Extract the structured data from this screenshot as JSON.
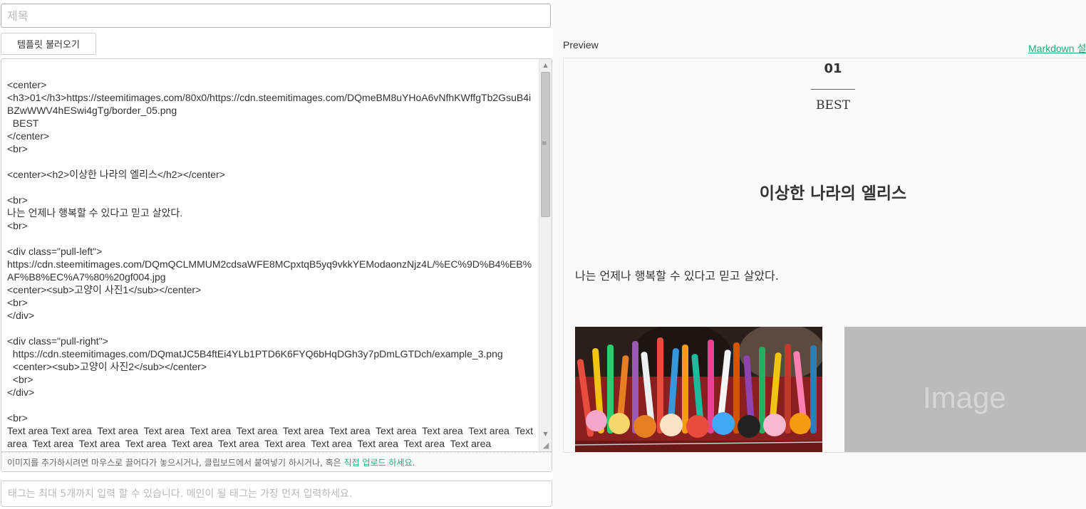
{
  "editor": {
    "title_placeholder": "제목",
    "template_button": "템플릿 불러오기",
    "body_text": "<center>\n<h3>01</h3>https://steemitimages.com/80x0/https://cdn.steemitimages.com/DQmeBM8uYHoA6vNfhKWffgTb2GsuB4iBZwWWV4hESwi4gTg/border_05.png\n  BEST\n</center>\n<br>\n\n<center><h2>이상한 나라의 엘리스</h2></center>\n\n<br>\n나는 언제나 행복할 수 있다고 믿고 살았다.\n<br>\n\n<div class=\"pull-left\">\nhttps://cdn.steemitimages.com/DQmQCLMMUM2cdsaWFE8MCpxtqB5yq9vkkYEModaonzNjz4L/%EC%9D%B4%EB%AF%B8%EC%A7%80%20gf004.jpg\n<center><sub>고양이 사진1</sub></center>\n<br>\n</div>\n\n<div class=\"pull-right\">\n  https://cdn.steemitimages.com/DQmatJC5B4ftEi4YLb1PTD6K6FYQ6bHqDGh3y7pDmLGTDch/example_3.png\n  <center><sub>고양이 사진2</sub></center>\n  <br>\n</div>\n\n<br>\nText area Text area  Text area  Text area  Text area  Text area  Text area  Text area  Text area  Text area  Text area  Text area  Text area  Text area  Text area  Text area  Text area  Text area  Text area  Text area  Text area  Text area",
    "upload_hint_prefix": "이미지를 추가하시려면 마우스로 끌어다가 놓으시거나, 클립보드에서 붙여넣기 하시거나, 혹은 ",
    "upload_hint_link": "직접 업로드 하세요",
    "upload_hint_suffix": ".",
    "tags_placeholder": "태그는 최대 5개까지 입력 할 수 있습니다. 메인이 될 태그는 가장 먼저 입력하세요."
  },
  "preview": {
    "label": "Preview",
    "markdown_link": "Markdown 설",
    "number": "01",
    "best": "BEST",
    "heading": "이상한 나라의 엘리스",
    "paragraph": "나는 언제나 행복할 수 있다고 믿고 살았다.",
    "placeholder_image_text": "Image"
  },
  "colors": {
    "accent_link": "#1fad7b",
    "placeholder_gray": "#bbbbbb"
  }
}
